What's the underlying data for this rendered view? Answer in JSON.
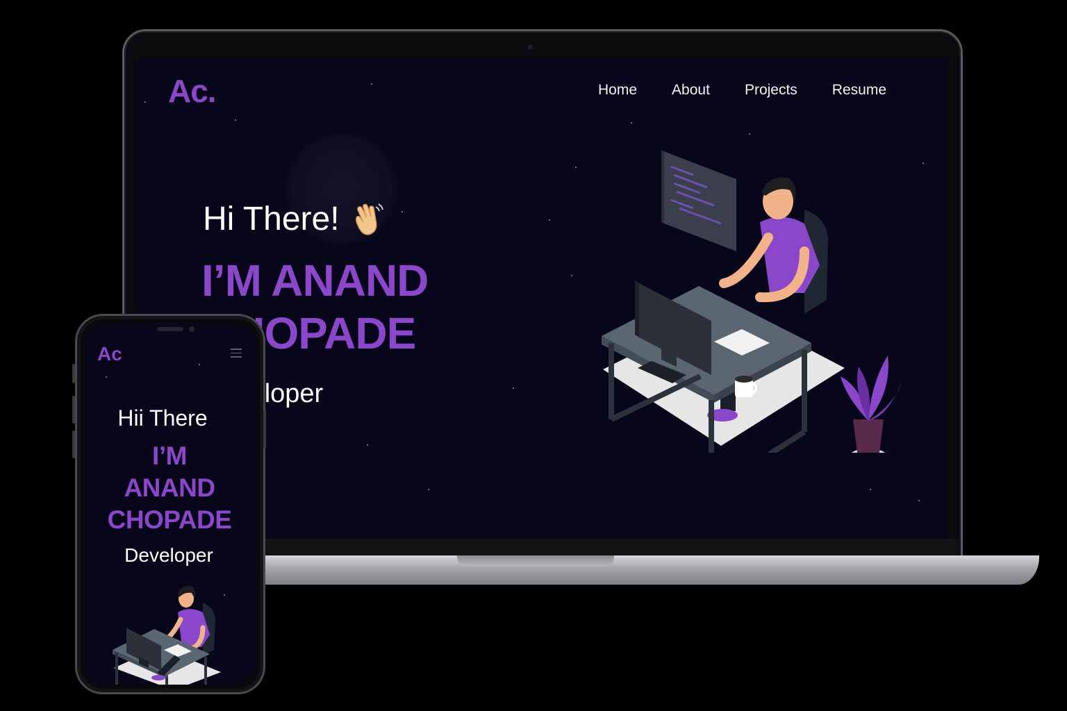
{
  "laptop": {
    "logo": "Ac.",
    "nav": [
      "Home",
      "About",
      "Projects",
      "Resume"
    ],
    "greeting": "Hi There!",
    "wave_icon": "waving-hand-icon",
    "name_line1": "I’M ANAND",
    "name_line2": "CHOPADE",
    "role": "Developer"
  },
  "phone": {
    "logo": "Ac",
    "menu_icon": "hamburger-menu-icon",
    "greeting": "Hii There",
    "name_line1": "I’M",
    "name_line2": "ANAND",
    "name_line3": "CHOPADE",
    "role": "Developer"
  },
  "colors": {
    "accent": "#8b47c9",
    "background": "#07061a",
    "text": "#ffffff"
  }
}
